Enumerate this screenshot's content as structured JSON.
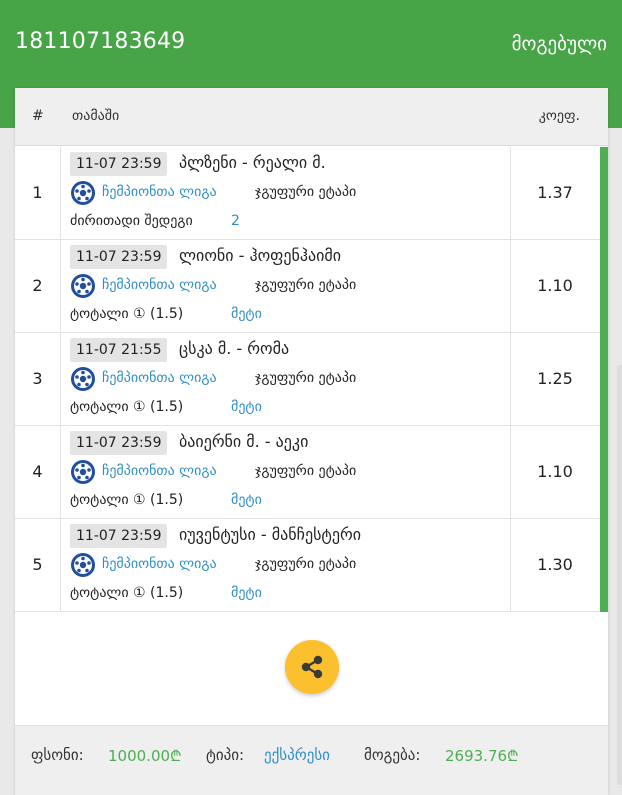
{
  "header": {
    "ticket_id": "181107183649",
    "status": "მოგებული"
  },
  "table": {
    "col_num": "#",
    "col_game": "თამაში",
    "col_odd": "კოეფ."
  },
  "rows": [
    {
      "num": "1",
      "time": "11-07 23:59",
      "match": "პლზენი - რეალი მ.",
      "league": "ჩემპიონთა ლიგა",
      "stage": "ჯგუფური ეტაპი",
      "market": "ძირითადი შედეგი",
      "pick": "2",
      "odd": "1.37"
    },
    {
      "num": "2",
      "time": "11-07 23:59",
      "match": "ლიონი - ჰოფენჰაიმი",
      "league": "ჩემპიონთა ლიგა",
      "stage": "ჯგუფური ეტაპი",
      "market": "ტოტალი ① (1.5)",
      "pick": "მეტი",
      "odd": "1.10"
    },
    {
      "num": "3",
      "time": "11-07 21:55",
      "match": "ცსკა მ. - რომა",
      "league": "ჩემპიონთა ლიგა",
      "stage": "ჯგუფური ეტაპი",
      "market": "ტოტალი ① (1.5)",
      "pick": "მეტი",
      "odd": "1.25"
    },
    {
      "num": "4",
      "time": "11-07 23:59",
      "match": "ბაიერნი მ. - აეკი",
      "league": "ჩემპიონთა ლიგა",
      "stage": "ჯგუფური ეტაპი",
      "market": "ტოტალი ① (1.5)",
      "pick": "მეტი",
      "odd": "1.10"
    },
    {
      "num": "5",
      "time": "11-07 23:59",
      "match": "იუვენტუსი - მანჩესტერი",
      "league": "ჩემპიონთა ლიგა",
      "stage": "ჯგუფური ეტაპი",
      "market": "ტოტალი ① (1.5)",
      "pick": "მეტი",
      "odd": "1.30"
    }
  ],
  "share_icon": "share-icon",
  "footer": {
    "stake_label": "ფსონი:",
    "stake_value": "1000.00₾",
    "type_label": "ტიპი:",
    "type_value": "ექსპრესი",
    "win_label": "მოგება:",
    "win_value": "2693.76₾"
  },
  "colors": {
    "brand_green": "#47a447",
    "win_stripe": "#4caf50",
    "link_blue": "#2f8fc7",
    "share_yellow": "#fbc02d"
  }
}
